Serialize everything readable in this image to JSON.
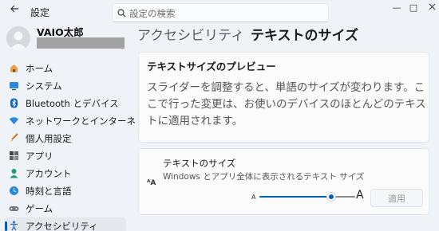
{
  "window": {
    "title": "設定",
    "minimize": "—",
    "maximize": "□"
  },
  "search": {
    "placeholder": "設定の検索"
  },
  "user": {
    "name": "VAIO太郎"
  },
  "sidebar": {
    "items": [
      {
        "label": "ホーム",
        "icon": "home-icon",
        "active": false
      },
      {
        "label": "システム",
        "icon": "system-icon",
        "active": false
      },
      {
        "label": "Bluetooth とデバイス",
        "icon": "bluetooth-icon",
        "active": false
      },
      {
        "label": "ネットワークとインターネ",
        "icon": "network-icon",
        "active": false
      },
      {
        "label": "個人用設定",
        "icon": "personalization-icon",
        "active": false
      },
      {
        "label": "アプリ",
        "icon": "apps-icon",
        "active": false
      },
      {
        "label": "アカウント",
        "icon": "accounts-icon",
        "active": false
      },
      {
        "label": "時刻と言語",
        "icon": "time-language-icon",
        "active": false
      },
      {
        "label": "ゲーム",
        "icon": "gaming-icon",
        "active": false
      },
      {
        "label": "アクセシビリティ",
        "icon": "accessibility-icon",
        "active": true
      }
    ]
  },
  "breadcrumb": {
    "parent": "アクセシビリティ",
    "separator": "›",
    "current": "テキストのサイズ"
  },
  "preview": {
    "title": "テキストサイズのプレビュー",
    "body": "スライダーを調整すると、単語のサイズが変わります。ここで行った変更は、お使いのデバイスのほとんどのテキストに適用されます。"
  },
  "text_size": {
    "icon_text": "ᴬA",
    "title": "テキストのサイズ",
    "description": "Windows とアプリ全体に表示されるテキスト サイズ",
    "small_label": "A",
    "large_label": "A",
    "slider_fraction": 0.75,
    "apply_label": "適用"
  },
  "colors": {
    "accent": "#005fb8",
    "background": "#eff3f8",
    "card": "#fbfbfc"
  }
}
